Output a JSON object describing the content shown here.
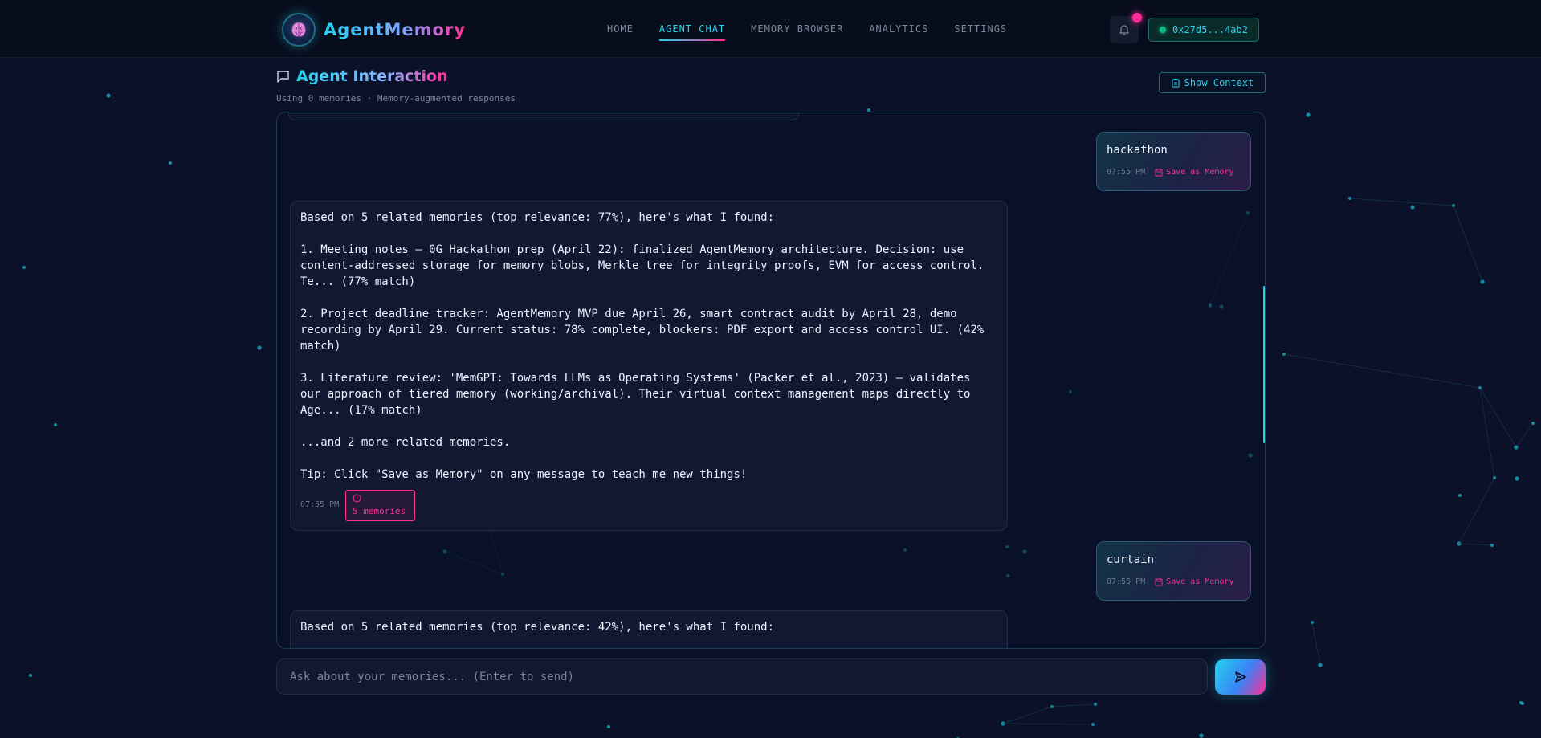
{
  "app": {
    "name_part1": "AgentMem",
    "name_part2": "ory",
    "brand_colors": {
      "cyan": "#22d3ee",
      "pink": "#ff2d95",
      "bg": "#0a1128"
    }
  },
  "nav": {
    "links": [
      "HOME",
      "AGENT CHAT",
      "MEMORY BROWSER",
      "ANALYTICS",
      "SETTINGS"
    ],
    "active_index": 1,
    "bell_icon": "bell-icon",
    "wallet_address": "0x27d5...4ab2"
  },
  "page": {
    "title": "Agent Interaction",
    "subtitle": "Using 0 memories · Memory-augmented responses",
    "show_context_label": "Show Context"
  },
  "messages": [
    {
      "role": "user",
      "text": "hackathon",
      "time": "07:55 PM",
      "save_label": "Save as Memory"
    },
    {
      "role": "agent",
      "lines": [
        "Based on 5 related memories (top relevance: 77%), here's what I found:",
        "",
        "1. Meeting notes — 0G Hackathon prep (April 22): finalized AgentMemory architecture. Decision: use",
        "content-addressed storage for memory blobs, Merkle tree for integrity proofs, EVM for access control.",
        "Te... (77% match)",
        "",
        "2. Project deadline tracker: AgentMemory MVP due April 26, smart contract audit by April 28, demo",
        "recording by April 29. Current status: 78% complete, blockers: PDF export and access control UI. (42%",
        "match)",
        "",
        "3. Literature review: 'MemGPT: Towards LLMs as Operating Systems' (Packer et al., 2023) — validates",
        "our approach of tiered memory (working/archival). Their virtual context management maps directly to",
        "Age... (17% match)",
        "",
        "...and 2 more related memories.",
        "",
        "Tip: Click \"Save as Memory\" on any message to teach me new things!"
      ],
      "time": "07:55 PM",
      "memories_chip": "5 memories",
      "chip_icon": "info-icon"
    },
    {
      "role": "user",
      "text": "curtain",
      "time": "07:55 PM",
      "save_label": "Save as Memory"
    },
    {
      "role": "agent",
      "lines": [
        "Based on 5 related memories (top relevance: 42%), here's what I found:"
      ]
    }
  ],
  "composer": {
    "placeholder": "Ask about your memories... (Enter to send)",
    "send_icon": "send-icon"
  }
}
